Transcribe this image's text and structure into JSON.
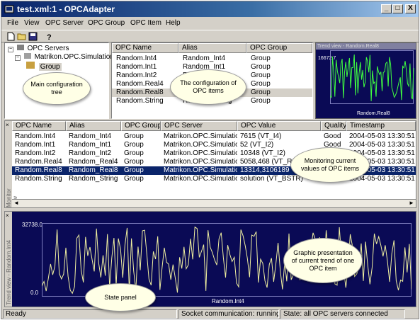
{
  "window": {
    "title": "test.xml:1 - OPCAdapter",
    "min": "_",
    "max": "□",
    "close": "X"
  },
  "menu": [
    "File",
    "View",
    "OPC Server",
    "OPC Group",
    "OPC Item",
    "Help"
  ],
  "tree": {
    "root": "OPC Servers",
    "server": "Matrikon.OPC.Simulation",
    "group": "Group"
  },
  "items_table": {
    "headers": [
      "OPC Name",
      "Alias",
      "OPC Group"
    ],
    "rows": [
      [
        "Random.Int4",
        "Random_Int4",
        "Group"
      ],
      [
        "Random.Int1",
        "Random_Int1",
        "Group"
      ],
      [
        "Random.Int2",
        "Random_Int2",
        "Group"
      ],
      [
        "Random.Real4",
        "Random_Real4",
        "Group"
      ],
      [
        "Random.Real8",
        "Random_Real8",
        "Group"
      ],
      [
        "Random.String",
        "Random_String",
        "Group"
      ]
    ]
  },
  "trend_small": {
    "title": "Trend view - Random.Real8",
    "ymax": "16672.7",
    "xlabel": "Random.Real8"
  },
  "monitor": {
    "side_label": "Monitor view",
    "headers": [
      "OPC Name",
      "Alias",
      "OPC Group",
      "OPC Server",
      "OPC Value",
      "Quality",
      "Timestamp"
    ],
    "rows": [
      [
        "Random.Int4",
        "Random_Int4",
        "Group",
        "Matrikon.OPC.Simulation",
        "7615 (VT_I4)",
        "Good",
        "2004-05-03 13:30:51"
      ],
      [
        "Random.Int1",
        "Random_Int1",
        "Group",
        "Matrikon.OPC.Simulation",
        "52 (VT_I2)",
        "Good",
        "2004-05-03 13:30:51"
      ],
      [
        "Random.Int2",
        "Random_Int2",
        "Group",
        "Matrikon.OPC.Simulation",
        "10348 (VT_I2)",
        "Good",
        "2004-05-03 13:30:51"
      ],
      [
        "Random.Real4",
        "Random_Real4",
        "Group",
        "Matrikon.OPC.Simulation",
        "5058,468 (VT_R4)",
        "Good",
        "2004-05-03 13:30:51"
      ],
      [
        "Random.Real8",
        "Random_Real8",
        "Group",
        "Matrikon.OPC.Simulation",
        "13314,3106189",
        "Good",
        "2004-05-03 13:30:51"
      ],
      [
        "Random.String",
        "Random_String",
        "Group",
        "Matrikon.OPC.Simulation",
        "solution (VT_BSTR)",
        "Good",
        "2004-05-03 13:30:51"
      ]
    ],
    "selected_index": 4
  },
  "trend_main": {
    "side_label": "Trend view - Random.Int4",
    "ymax": "32738.0",
    "ymin": "0.0",
    "xlabel": "Random.Int4"
  },
  "callouts": {
    "tree": "Main configuration tree",
    "items": "The configuration of OPC items",
    "monitor": "Monitoring current values of OPC items",
    "graphic": "Graphic presentation of current trend of one OPC item",
    "state": "State panel"
  },
  "status": {
    "ready": "Ready",
    "socket": "Socket communication: running",
    "state": "State: all OPC servers connected"
  },
  "colors": {
    "selection": "#0a246a",
    "trend_bg": "#0a0a55",
    "trend_line": "#f0f0a0",
    "trend_small_line": "#40ff40"
  }
}
